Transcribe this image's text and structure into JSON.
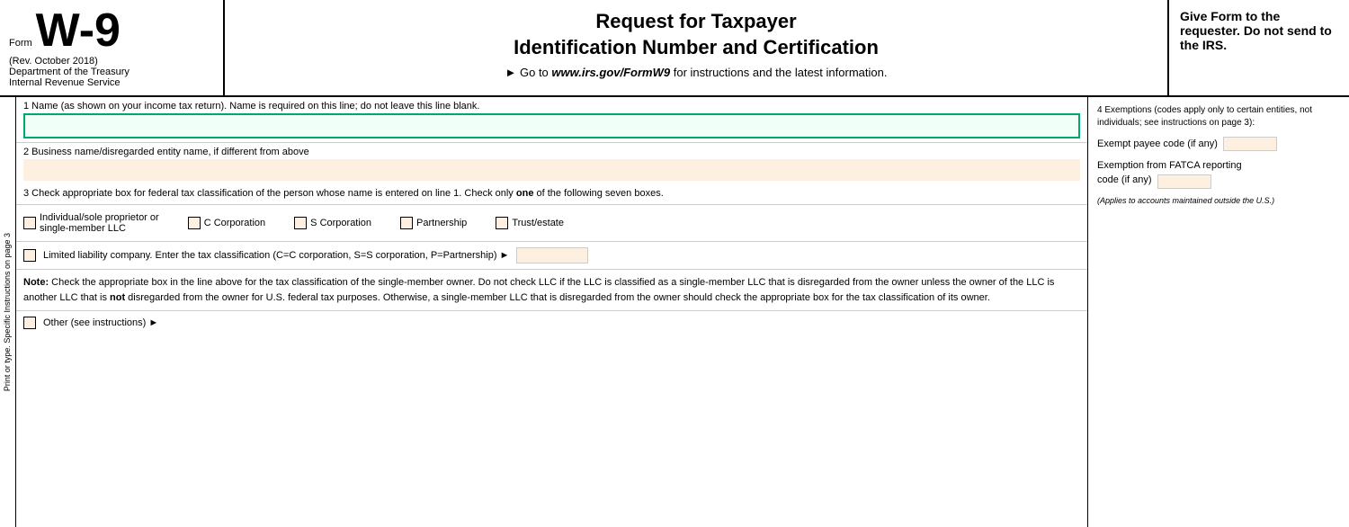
{
  "header": {
    "form_label": "Form",
    "form_number": "W-9",
    "rev": "(Rev. October 2018)",
    "dept1": "Department of the Treasury",
    "dept2": "Internal Revenue Service",
    "title_line1": "Request for Taxpayer",
    "title_line2": "Identification Number and Certification",
    "goto": "► Go to ",
    "goto_url": "www.irs.gov/FormW9",
    "goto_suffix": " for instructions and the latest information.",
    "right_text": "Give Form to the requester. Do not send to the IRS."
  },
  "fields": {
    "field1_label": "1  Name (as shown on your income tax return). Name is required on this line; do not leave this line blank.",
    "field2_label": "2  Business name/disregarded entity name, if different from above"
  },
  "section3": {
    "header": "3  Check appropriate box for federal tax classification of the person whose name is entered on line 1. Check only ",
    "header_bold": "one",
    "header_suffix": " of the following seven boxes.",
    "checkboxes": [
      {
        "label": "Individual/sole proprietor or\nsingle-member LLC"
      },
      {
        "label": "C Corporation"
      },
      {
        "label": "S Corporation"
      },
      {
        "label": "Partnership"
      },
      {
        "label": "Trust/estate"
      }
    ],
    "llc_text": "Limited liability company. Enter the tax classification (C=C corporation, S=S corporation, P=Partnership) ►",
    "note_bold": "Note:",
    "note_text": " Check the appropriate box in the line above for the tax classification of the single-member owner.  Do not check LLC if the LLC is classified as a single-member LLC that is disregarded from the owner unless the owner of the LLC is another LLC that is ",
    "note_not_bold": "not",
    "note_text2": " disregarded from the owner for U.S. federal tax purposes. Otherwise, a single-member LLC that is disregarded from the owner should check the appropriate box for the tax classification of its owner.",
    "other_label": "Other (see instructions) ►"
  },
  "section4": {
    "title": "4  Exemptions (codes apply only to certain entities, not individuals; see instructions on page 3):",
    "exempt_payee_label": "Exempt payee code (if any)",
    "fatca_label": "Exemption from FATCA reporting",
    "fatca_label2": "code (if any)",
    "applies_note": "(Applies to accounts maintained outside the U.S.)"
  },
  "side_label": {
    "text": "Print or type.    Specific Instructions on page 3"
  }
}
